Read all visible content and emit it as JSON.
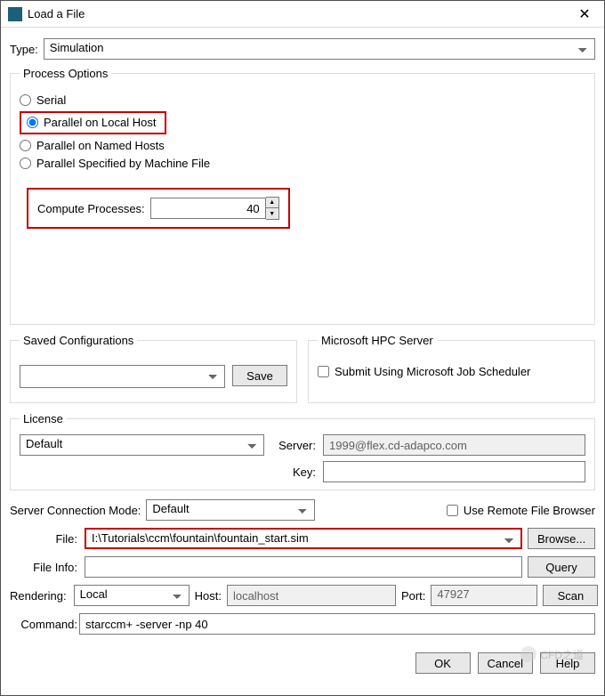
{
  "titlebar": {
    "title": "Load a File"
  },
  "type": {
    "label": "Type:",
    "value": "Simulation"
  },
  "process_options": {
    "legend": "Process Options",
    "radios": [
      {
        "label": "Serial",
        "checked": false
      },
      {
        "label": "Parallel on Local Host",
        "checked": true
      },
      {
        "label": "Parallel on Named Hosts",
        "checked": false
      },
      {
        "label": "Parallel Specified by Machine File",
        "checked": false
      }
    ],
    "compute_label": "Compute Processes:",
    "compute_value": "40"
  },
  "saved_configs": {
    "legend": "Saved Configurations",
    "value": "",
    "save_btn": "Save"
  },
  "hpc": {
    "legend": "Microsoft HPC Server",
    "checkbox_label": "Submit Using Microsoft Job Scheduler",
    "checked": false
  },
  "license": {
    "legend": "License",
    "value": "Default",
    "server_label": "Server:",
    "server_value": "1999@flex.cd-adapco.com",
    "key_label": "Key:",
    "key_value": ""
  },
  "server_mode": {
    "label": "Server Connection Mode:",
    "value": "Default"
  },
  "remote_browser": {
    "label": "Use Remote File Browser",
    "checked": false
  },
  "file": {
    "label": "File:",
    "value": "I:\\Tutorials\\ccm\\fountain\\fountain_start.sim",
    "browse_btn": "Browse..."
  },
  "file_info": {
    "label": "File Info:",
    "value": "",
    "query_btn": "Query"
  },
  "rendering": {
    "label": "Rendering:",
    "value": "Local",
    "host_label": "Host:",
    "host_value": "localhost",
    "port_label": "Port:",
    "port_value": "47927",
    "scan_btn": "Scan"
  },
  "command": {
    "label": "Command:",
    "value": "starccm+ -server -np 40"
  },
  "buttons": {
    "ok": "OK",
    "cancel": "Cancel",
    "help": "Help"
  },
  "watermark": "CFD之道"
}
